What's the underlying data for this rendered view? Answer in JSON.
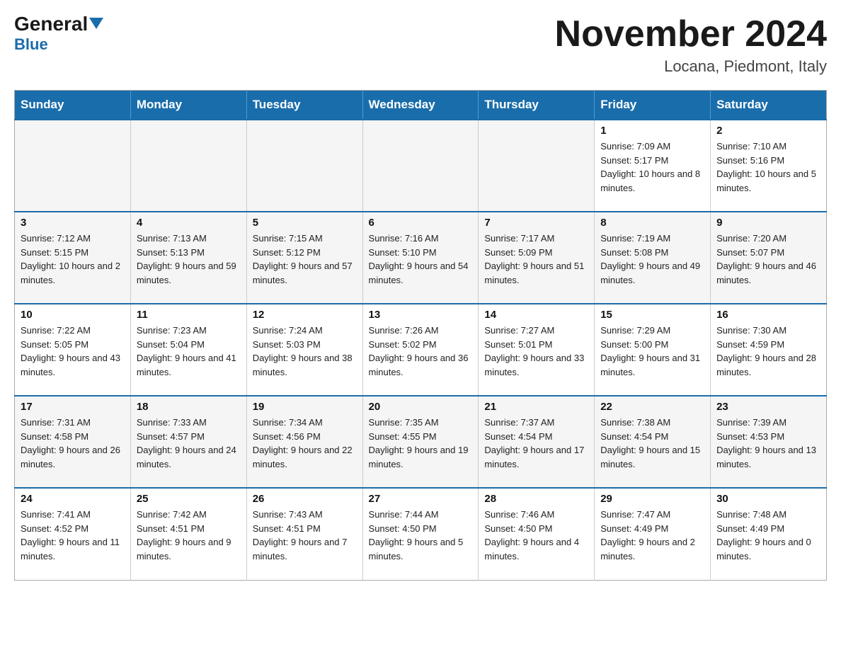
{
  "header": {
    "logo_line1": "General",
    "logo_line2": "Blue",
    "month_title": "November 2024",
    "location": "Locana, Piedmont, Italy"
  },
  "weekdays": [
    "Sunday",
    "Monday",
    "Tuesday",
    "Wednesday",
    "Thursday",
    "Friday",
    "Saturday"
  ],
  "weeks": [
    [
      {
        "day": "",
        "sunrise": "",
        "sunset": "",
        "daylight": "",
        "empty": true
      },
      {
        "day": "",
        "sunrise": "",
        "sunset": "",
        "daylight": "",
        "empty": true
      },
      {
        "day": "",
        "sunrise": "",
        "sunset": "",
        "daylight": "",
        "empty": true
      },
      {
        "day": "",
        "sunrise": "",
        "sunset": "",
        "daylight": "",
        "empty": true
      },
      {
        "day": "",
        "sunrise": "",
        "sunset": "",
        "daylight": "",
        "empty": true
      },
      {
        "day": "1",
        "sunrise": "Sunrise: 7:09 AM",
        "sunset": "Sunset: 5:17 PM",
        "daylight": "Daylight: 10 hours and 8 minutes.",
        "empty": false
      },
      {
        "day": "2",
        "sunrise": "Sunrise: 7:10 AM",
        "sunset": "Sunset: 5:16 PM",
        "daylight": "Daylight: 10 hours and 5 minutes.",
        "empty": false
      }
    ],
    [
      {
        "day": "3",
        "sunrise": "Sunrise: 7:12 AM",
        "sunset": "Sunset: 5:15 PM",
        "daylight": "Daylight: 10 hours and 2 minutes.",
        "empty": false
      },
      {
        "day": "4",
        "sunrise": "Sunrise: 7:13 AM",
        "sunset": "Sunset: 5:13 PM",
        "daylight": "Daylight: 9 hours and 59 minutes.",
        "empty": false
      },
      {
        "day": "5",
        "sunrise": "Sunrise: 7:15 AM",
        "sunset": "Sunset: 5:12 PM",
        "daylight": "Daylight: 9 hours and 57 minutes.",
        "empty": false
      },
      {
        "day": "6",
        "sunrise": "Sunrise: 7:16 AM",
        "sunset": "Sunset: 5:10 PM",
        "daylight": "Daylight: 9 hours and 54 minutes.",
        "empty": false
      },
      {
        "day": "7",
        "sunrise": "Sunrise: 7:17 AM",
        "sunset": "Sunset: 5:09 PM",
        "daylight": "Daylight: 9 hours and 51 minutes.",
        "empty": false
      },
      {
        "day": "8",
        "sunrise": "Sunrise: 7:19 AM",
        "sunset": "Sunset: 5:08 PM",
        "daylight": "Daylight: 9 hours and 49 minutes.",
        "empty": false
      },
      {
        "day": "9",
        "sunrise": "Sunrise: 7:20 AM",
        "sunset": "Sunset: 5:07 PM",
        "daylight": "Daylight: 9 hours and 46 minutes.",
        "empty": false
      }
    ],
    [
      {
        "day": "10",
        "sunrise": "Sunrise: 7:22 AM",
        "sunset": "Sunset: 5:05 PM",
        "daylight": "Daylight: 9 hours and 43 minutes.",
        "empty": false
      },
      {
        "day": "11",
        "sunrise": "Sunrise: 7:23 AM",
        "sunset": "Sunset: 5:04 PM",
        "daylight": "Daylight: 9 hours and 41 minutes.",
        "empty": false
      },
      {
        "day": "12",
        "sunrise": "Sunrise: 7:24 AM",
        "sunset": "Sunset: 5:03 PM",
        "daylight": "Daylight: 9 hours and 38 minutes.",
        "empty": false
      },
      {
        "day": "13",
        "sunrise": "Sunrise: 7:26 AM",
        "sunset": "Sunset: 5:02 PM",
        "daylight": "Daylight: 9 hours and 36 minutes.",
        "empty": false
      },
      {
        "day": "14",
        "sunrise": "Sunrise: 7:27 AM",
        "sunset": "Sunset: 5:01 PM",
        "daylight": "Daylight: 9 hours and 33 minutes.",
        "empty": false
      },
      {
        "day": "15",
        "sunrise": "Sunrise: 7:29 AM",
        "sunset": "Sunset: 5:00 PM",
        "daylight": "Daylight: 9 hours and 31 minutes.",
        "empty": false
      },
      {
        "day": "16",
        "sunrise": "Sunrise: 7:30 AM",
        "sunset": "Sunset: 4:59 PM",
        "daylight": "Daylight: 9 hours and 28 minutes.",
        "empty": false
      }
    ],
    [
      {
        "day": "17",
        "sunrise": "Sunrise: 7:31 AM",
        "sunset": "Sunset: 4:58 PM",
        "daylight": "Daylight: 9 hours and 26 minutes.",
        "empty": false
      },
      {
        "day": "18",
        "sunrise": "Sunrise: 7:33 AM",
        "sunset": "Sunset: 4:57 PM",
        "daylight": "Daylight: 9 hours and 24 minutes.",
        "empty": false
      },
      {
        "day": "19",
        "sunrise": "Sunrise: 7:34 AM",
        "sunset": "Sunset: 4:56 PM",
        "daylight": "Daylight: 9 hours and 22 minutes.",
        "empty": false
      },
      {
        "day": "20",
        "sunrise": "Sunrise: 7:35 AM",
        "sunset": "Sunset: 4:55 PM",
        "daylight": "Daylight: 9 hours and 19 minutes.",
        "empty": false
      },
      {
        "day": "21",
        "sunrise": "Sunrise: 7:37 AM",
        "sunset": "Sunset: 4:54 PM",
        "daylight": "Daylight: 9 hours and 17 minutes.",
        "empty": false
      },
      {
        "day": "22",
        "sunrise": "Sunrise: 7:38 AM",
        "sunset": "Sunset: 4:54 PM",
        "daylight": "Daylight: 9 hours and 15 minutes.",
        "empty": false
      },
      {
        "day": "23",
        "sunrise": "Sunrise: 7:39 AM",
        "sunset": "Sunset: 4:53 PM",
        "daylight": "Daylight: 9 hours and 13 minutes.",
        "empty": false
      }
    ],
    [
      {
        "day": "24",
        "sunrise": "Sunrise: 7:41 AM",
        "sunset": "Sunset: 4:52 PM",
        "daylight": "Daylight: 9 hours and 11 minutes.",
        "empty": false
      },
      {
        "day": "25",
        "sunrise": "Sunrise: 7:42 AM",
        "sunset": "Sunset: 4:51 PM",
        "daylight": "Daylight: 9 hours and 9 minutes.",
        "empty": false
      },
      {
        "day": "26",
        "sunrise": "Sunrise: 7:43 AM",
        "sunset": "Sunset: 4:51 PM",
        "daylight": "Daylight: 9 hours and 7 minutes.",
        "empty": false
      },
      {
        "day": "27",
        "sunrise": "Sunrise: 7:44 AM",
        "sunset": "Sunset: 4:50 PM",
        "daylight": "Daylight: 9 hours and 5 minutes.",
        "empty": false
      },
      {
        "day": "28",
        "sunrise": "Sunrise: 7:46 AM",
        "sunset": "Sunset: 4:50 PM",
        "daylight": "Daylight: 9 hours and 4 minutes.",
        "empty": false
      },
      {
        "day": "29",
        "sunrise": "Sunrise: 7:47 AM",
        "sunset": "Sunset: 4:49 PM",
        "daylight": "Daylight: 9 hours and 2 minutes.",
        "empty": false
      },
      {
        "day": "30",
        "sunrise": "Sunrise: 7:48 AM",
        "sunset": "Sunset: 4:49 PM",
        "daylight": "Daylight: 9 hours and 0 minutes.",
        "empty": false
      }
    ]
  ]
}
